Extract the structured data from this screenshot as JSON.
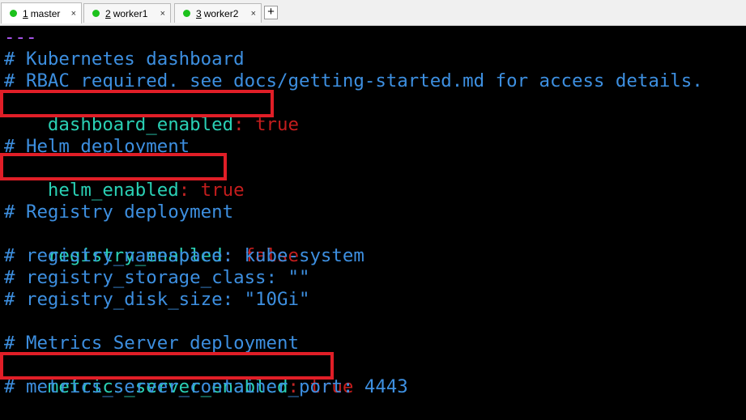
{
  "tabs": [
    {
      "number": "1",
      "label": "master",
      "active": true
    },
    {
      "number": "2",
      "label": "worker1",
      "active": false
    },
    {
      "number": "3",
      "label": "worker2",
      "active": false
    }
  ],
  "tab_close_glyph": "×",
  "new_tab_glyph": "+",
  "colors": {
    "background": "#000000",
    "comment": "#3d8fe0",
    "key": "#2ad0b4",
    "value": "#c41d1d",
    "separator": "#b65cff",
    "highlight_box": "#e01e27",
    "tab_status": "#1cc21c"
  },
  "editor": {
    "separator": "---",
    "comment_dashboard": "# Kubernetes dashboard",
    "comment_rbac": "# RBAC required. see docs/getting-started.md for access details.",
    "dashboard_key": "dashboard_enabled",
    "dashboard_value": "true",
    "comment_helm": "# Helm deployment",
    "helm_key": "helm_enabled",
    "helm_value": "true",
    "comment_registry": "# Registry deployment",
    "registry_key": "registry_enabled",
    "registry_value": "false",
    "comment_registry_namespace": "# registry_namespace: kube-system",
    "comment_registry_storage": "# registry_storage_class: \"\"",
    "comment_registry_disk": "# registry_disk_size: \"10Gi\"",
    "comment_metrics": "# Metrics Server deployment",
    "metrics_key": "metrics_server_enabled",
    "metrics_value": "true",
    "comment_metrics_port": "# metrics_server_container_port: 4443",
    "colon": ": "
  }
}
